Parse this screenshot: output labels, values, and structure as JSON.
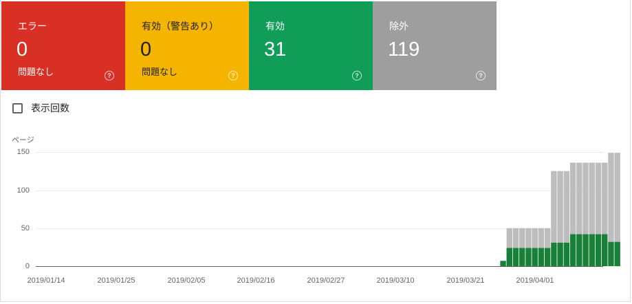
{
  "tiles": [
    {
      "label": "エラー",
      "count": "0",
      "sub": "問題なし",
      "color": "#d93025",
      "help": "?"
    },
    {
      "label": "有効（警告あり）",
      "count": "0",
      "sub": "問題なし",
      "color": "#f4b400",
      "help": "?"
    },
    {
      "label": "有効",
      "count": "31",
      "sub": "",
      "color": "#0f9d58",
      "help": "?"
    },
    {
      "label": "除外",
      "count": "119",
      "sub": "",
      "color": "#9e9e9e",
      "help": "?"
    }
  ],
  "impressions_label": "表示回数",
  "chart_data": {
    "type": "bar",
    "ylabel": "ページ",
    "ylim": [
      0,
      150
    ],
    "yticks": [
      "150",
      "100",
      "50",
      "0"
    ],
    "xticks": [
      "2019/01/14",
      "2019/01/25",
      "2019/02/05",
      "2019/02/16",
      "2019/02/27",
      "2019/03/10",
      "2019/03/21",
      "2019/04/01"
    ],
    "start_date": "2019-01-14",
    "series": [
      {
        "name": "有効",
        "color": "#188038",
        "values_from_day": 72,
        "values": [
          7,
          24,
          24,
          24,
          24,
          24,
          24,
          24,
          31,
          31,
          31,
          42,
          42,
          42,
          42,
          42,
          42,
          32,
          32
        ]
      },
      {
        "name": "除外",
        "color": "#bdbdbd",
        "values_from_day": 72,
        "values": [
          0,
          26,
          26,
          26,
          26,
          26,
          26,
          26,
          94,
          94,
          94,
          94,
          94,
          94,
          94,
          94,
          94,
          117,
          117
        ]
      }
    ]
  }
}
